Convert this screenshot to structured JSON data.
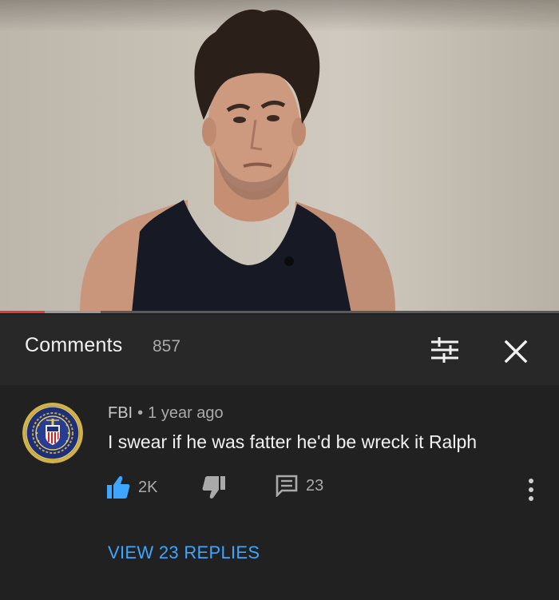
{
  "header": {
    "title": "Comments",
    "count": "857"
  },
  "video": {
    "progress_fraction": 0.08
  },
  "comment": {
    "author": "FBI",
    "separator": "•",
    "time": "1 year ago",
    "text": "I swear if he was fatter he'd be wreck it Ralph",
    "likes": "2K",
    "replies_count": "23",
    "view_replies_label": "VIEW 23 REPLIES"
  },
  "colors": {
    "background": "#212121",
    "header_bg": "#282828",
    "link_blue": "#3ea6ff",
    "progress_red": "#e53935"
  },
  "icons": [
    "sort-filter-icon",
    "close-icon",
    "thumb-up-icon",
    "thumb-down-icon",
    "reply-comment-icon",
    "more-vert-icon"
  ]
}
